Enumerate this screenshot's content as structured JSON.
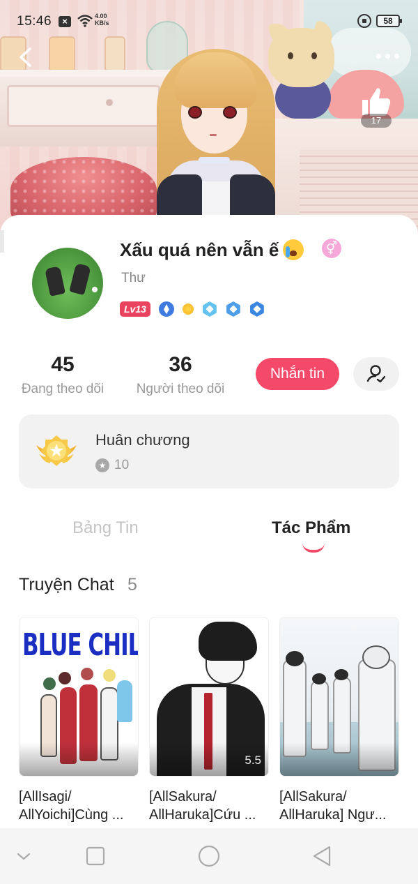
{
  "status_bar": {
    "time": "15:46",
    "network_speed_value": "4.00",
    "network_speed_unit": "KB/s",
    "battery": "58"
  },
  "banner": {
    "like_count": "17"
  },
  "profile": {
    "display_name": "Xấu quá nên vẫn ế",
    "gender_symbol": "⚥",
    "real_name": "Thư",
    "level": "Lv13",
    "following_count": "45",
    "following_label": "Đang theo dõi",
    "followers_count": "36",
    "followers_label": "Người theo dõi",
    "message_button": "Nhắn tin"
  },
  "medal": {
    "title": "Huân chương",
    "count": "10"
  },
  "tabs": {
    "news": "Bảng Tin",
    "works": "Tác Phẩm"
  },
  "section": {
    "title": "Truyện Chat",
    "count": "5"
  },
  "stories": [
    {
      "title_line1": "[AllIsagi/",
      "title_line2": "AllYoichi]Cùng ...",
      "cover_text": "BLUE CHILLER"
    },
    {
      "title_line1": "[AllSakura/",
      "title_line2": "AllHaruka]Cứu ...",
      "rating": "5.5"
    },
    {
      "title_line1": "[AllSakura/",
      "title_line2": "AllHaruka] Ngư..."
    }
  ],
  "icons": {
    "back": "chevron-left-icon",
    "more": "more-dots-icon",
    "like": "thumbs-up-icon",
    "user": "user-settings-icon",
    "medal": "medal-icon",
    "nav": [
      "chevron-down-icon",
      "square-icon",
      "circle-icon",
      "triangle-back-icon"
    ]
  },
  "colors": {
    "accent": "#f5496a",
    "level_badge": "#e9435f",
    "gender_badge": "#f6a9d9"
  }
}
